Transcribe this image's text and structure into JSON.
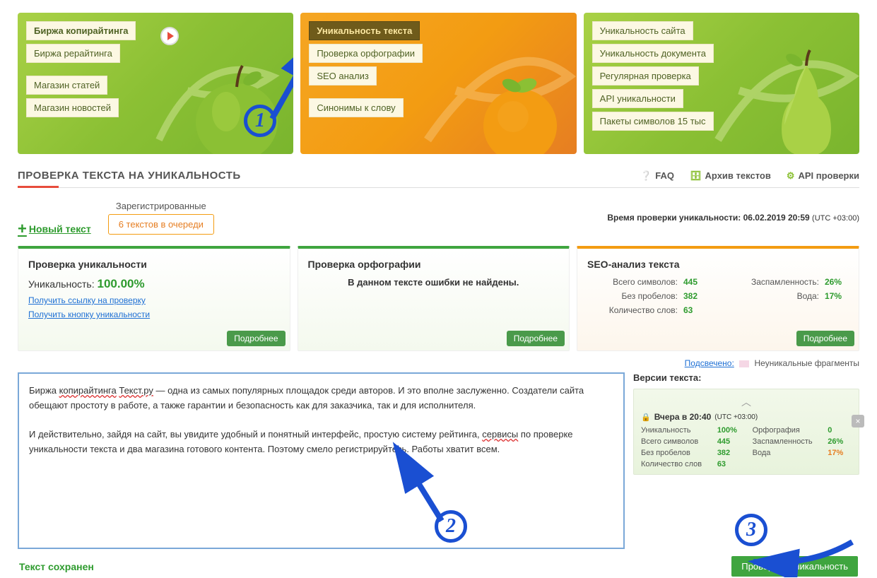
{
  "banners": {
    "green": {
      "links": [
        "Биржа копирайтинга",
        "Биржа рерайтинга",
        "Магазин статей",
        "Магазин новостей"
      ]
    },
    "orange": {
      "links": [
        "Уникальность текста",
        "Проверка орфографии",
        "SEO анализ",
        "Синонимы к слову"
      ]
    },
    "green2": {
      "links": [
        "Уникальность сайта",
        "Уникальность документа",
        "Регулярная проверка",
        "API уникальности",
        "Пакеты символов 15 тыс"
      ]
    }
  },
  "page_title": "ПРОВЕРКА ТЕКСТА НА УНИКАЛЬНОСТЬ",
  "top_links": {
    "faq": "FAQ",
    "archive": "Архив текстов",
    "api": "API проверки"
  },
  "new_text": "Новый текст",
  "queue": {
    "label": "Зарегистрированные",
    "value": "6 текстов в очереди"
  },
  "check_time": {
    "label": "Время проверки уникальности:",
    "value": "06.02.2019 20:59",
    "utc": "(UTC +03:00)"
  },
  "panel_uniq": {
    "title": "Проверка уникальности",
    "label": "Уникальность:",
    "value": "100.00%",
    "link1": "Получить ссылку на проверку",
    "link2": "Получить кнопку уникальности",
    "more": "Подробнее"
  },
  "panel_spell": {
    "title": "Проверка орфографии",
    "msg": "В данном тексте ошибки не найдены.",
    "more": "Подробнее"
  },
  "panel_seo": {
    "title": "SEO-анализ текста",
    "more": "Подробнее",
    "rows_left": [
      [
        "Всего символов:",
        "445"
      ],
      [
        "Без пробелов:",
        "382"
      ],
      [
        "Количество слов:",
        "63"
      ]
    ],
    "rows_right": [
      [
        "Заспамленность:",
        "26%"
      ],
      [
        "Вода:",
        "17%"
      ]
    ]
  },
  "highlight": {
    "link": "Подсвечено:",
    "label": "Неуникальные фрагменты"
  },
  "text_body": {
    "p1a": "Биржа ",
    "u1": "копирайтинга",
    "p1b": " ",
    "u2": "Текст.ру",
    "p1c": " — одна из самых популярных площадок среди авторов. И это вполне заслуженно. Создатели сайта обещают простоту в работе, а также гарантии и безопасность как для заказчика, так и для исполнителя.",
    "p2a": "И действительно, зайдя на сайт, вы увидите удобный и понятный интерфейс, простую систему рейтинга, ",
    "u3": "сервисы",
    "p2b": " по проверке уникальности текста и два магазина готового контента.  Поэтому смело регистрируйтесь. Работы хватит всем."
  },
  "versions": {
    "title": "Версии текста:",
    "card": {
      "when": "Вчера в 20:40",
      "utc": "(UTC +03:00)",
      "stats": [
        [
          "Уникальность",
          "100%",
          "Орфография",
          "0"
        ],
        [
          "Всего символов",
          "445",
          "Заспамленность",
          "26%"
        ],
        [
          "Без пробелов",
          "382",
          "Вода",
          "17%"
        ],
        [
          "Количество слов",
          "63",
          "",
          ""
        ]
      ]
    }
  },
  "saved": "Текст сохранен",
  "check_btn": "Проверить уникальность",
  "annot": {
    "n1": "1",
    "n2": "2",
    "n3": "3"
  }
}
